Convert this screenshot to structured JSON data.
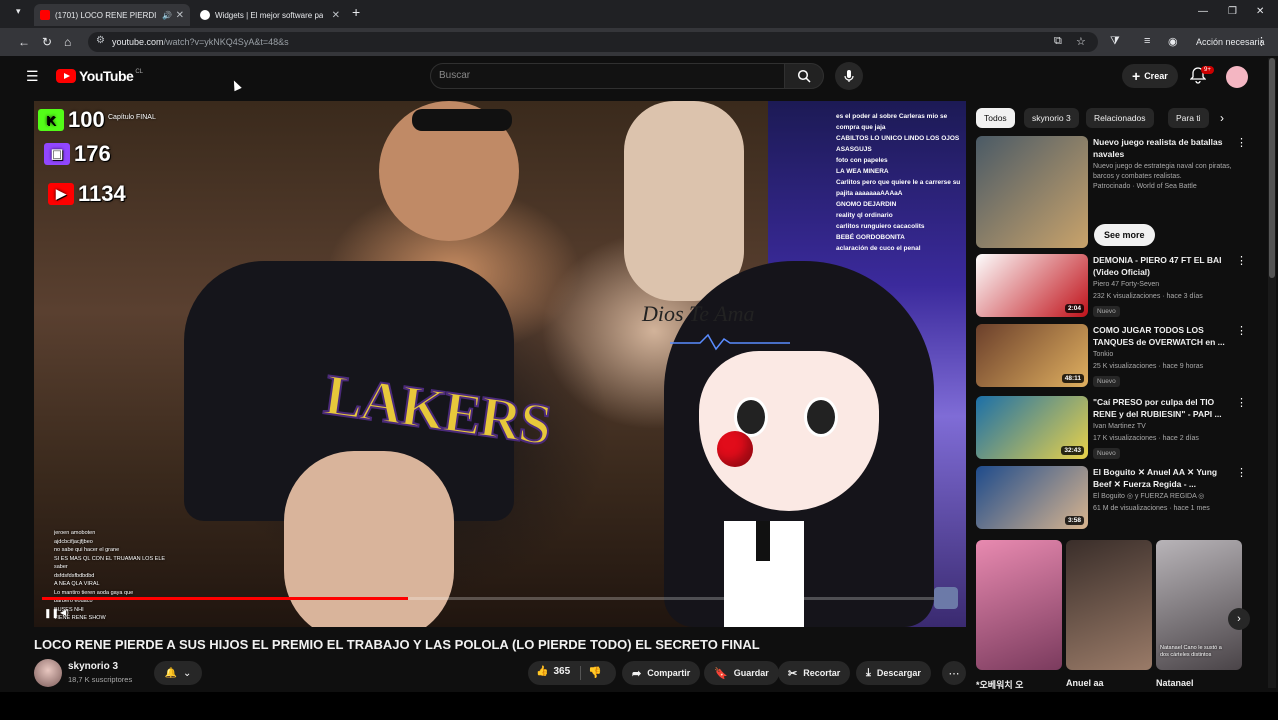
{
  "browser": {
    "tabs": [
      {
        "title": "(1701) LOCO RENE PIERDI",
        "active": true,
        "favicon_color": "#ff0000"
      },
      {
        "title": "Widgets | El mejor software pa",
        "active": false,
        "favicon_color": "#ffffff"
      }
    ],
    "url_host": "youtube.com",
    "url_path": "/watch?v=ykNKQ4SyA&t=48&s",
    "profile_label": "Acción necesaria"
  },
  "header": {
    "logo_text": "YouTube",
    "logo_country": "CL",
    "search_placeholder": "Buscar",
    "create_label": "Crear",
    "notifications_badge": "9+"
  },
  "player": {
    "stats": [
      {
        "icon": "kick-icon",
        "value": "100",
        "color": "#53fc18"
      },
      {
        "icon": "twitch-icon",
        "value": "176",
        "color": "#9146ff"
      },
      {
        "icon": "youtube-icon",
        "value": "1134",
        "color": "#ff0000"
      }
    ],
    "chapter_label": "Capítulo FINAL",
    "overlay_text": "Dios Te Ama",
    "jersey_text": "LAKERS",
    "chat": [
      {
        "user": "",
        "text": "es el poder al sobre Carleras mio se"
      },
      {
        "user": "",
        "text": "compra que jaja"
      },
      {
        "user": "",
        "text": "CABILTOS LO UNICO LINDO LOS OJOS"
      },
      {
        "user": "",
        "text": "ASASGUJS"
      },
      {
        "user": "",
        "text": "foto con papeles"
      },
      {
        "user": "",
        "text": "LA WEA MINERA"
      },
      {
        "user": "",
        "text": "Carlitos pero que quiere le a carrerse su"
      },
      {
        "user": "",
        "text": "pajita aaaaaaaAAAaA"
      },
      {
        "user": "",
        "text": "GNOMO DEJARDIN"
      },
      {
        "user": "",
        "text": "reality ql ordinario"
      },
      {
        "user": "",
        "text": "carlitos runguiero cacacolits"
      },
      {
        "user": "",
        "text": "BEBÉ GORDOBONITA"
      },
      {
        "user": "",
        "text": "aclaración de cuco el penal"
      }
    ],
    "mini_chat": [
      "jeroen amoboten",
      "ajdcbcifjacjfjbeo",
      "no sabe qui hacer el grane",
      "SI ES MAS QL CON EL TRUAMAN LOS ELE",
      "saber",
      "dsfdsfdsfbdbdbd",
      "A NEA QLA VIRAL",
      "Lo mantiro tieren aoda gaya que",
      "barbero eodaco",
      "BUSES NHI",
      "TIENE RENE SHOW"
    ],
    "progress_fraction": 0.4
  },
  "video": {
    "title": "LOCO RENE PIERDE A SUS HIJOS EL PREMIO EL TRABAJO Y LAS POLOLA (LO PIERDE TODO) EL SECRETO FINAL",
    "channel_name": "skynorio 3",
    "subscribers": "18,7 K suscriptores",
    "likes": "365",
    "share_label": "Compartir",
    "save_label": "Guardar",
    "clip_label": "Recortar",
    "download_label": "Descargar"
  },
  "sidebar": {
    "chips": [
      "Todos",
      "skynorio 3",
      "Relacionados",
      "Para ti"
    ],
    "see_more": "See more",
    "recs": [
      {
        "title": "Nuevo juego realista de batallas navales",
        "line1": "Nuevo juego de estrategia naval con piratas, barcos y combates realistas.",
        "line2": "Patrocinado · World of Sea Battle",
        "duration": "",
        "nuevo": "",
        "colors": [
          "#4a5a66",
          "#c9a36b"
        ]
      },
      {
        "title": "DEMONIA - PIERO 47 FT EL BAI (Video Oficial)",
        "line1": "Piero 47 Forty-Seven",
        "line2": "232 K visualizaciones · hace 3 días",
        "duration": "2:04",
        "nuevo": "Nuevo",
        "colors": [
          "#fdfdfd",
          "#c0121a"
        ]
      },
      {
        "title": "COMO JUGAR TODOS LOS TANQUES de OVERWATCH en ...",
        "line1": "Tonkio",
        "line2": "25 K visualizaciones · hace 9 horas",
        "duration": "48:11",
        "nuevo": "Nuevo",
        "colors": [
          "#6b3f2b",
          "#e0b060"
        ]
      },
      {
        "title": "\"Caí PRESO por culpa del TIO RENE y del RUBIESIN\" - PAPI ...",
        "line1": "Ivan Martinez TV",
        "line2": "17 K visualizaciones · hace 2 días",
        "duration": "32:43",
        "nuevo": "Nuevo",
        "colors": [
          "#1b6fa8",
          "#e9d24a"
        ]
      },
      {
        "title": "El Boguito ✕ Anuel AA ✕ Yung Beef ✕ Fuerza Regida - ...",
        "line1": "El Boguito ◎ y FUERZA REGIDA ◎",
        "line2": "61 M de visualizaciones · hace 1 mes",
        "duration": "3:58",
        "nuevo": "",
        "colors": [
          "#1e4b8c",
          "#d9b58e"
        ]
      }
    ],
    "shorts": [
      {
        "label": "*오베워치 오",
        "colors": [
          "#e88ab0",
          "#7b3b5e"
        ]
      },
      {
        "label": "Anuel aa",
        "colors": [
          "#3a2e2a",
          "#9a7b68"
        ]
      },
      {
        "label": "Natanael",
        "colors": [
          "#b8b4b8",
          "#4a4448"
        ]
      }
    ],
    "short_caption": "Natanael Cano le sustó a dos cárteles distintos"
  }
}
